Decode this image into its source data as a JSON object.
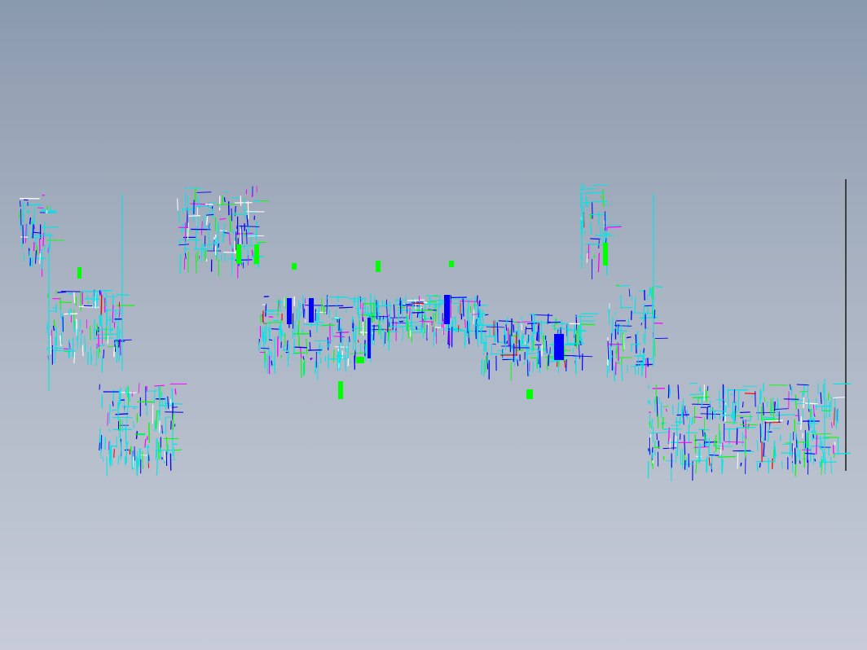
{
  "viewport": {
    "background_top": "#8a9aad",
    "background_bottom": "#c7ccd8",
    "border_line_color": "#1a1a1a"
  },
  "model": {
    "line_colors": [
      "#00e5e5",
      "#0000ff",
      "#00ff00",
      "#ff00ff",
      "#ffffff",
      "#ff0000"
    ]
  }
}
